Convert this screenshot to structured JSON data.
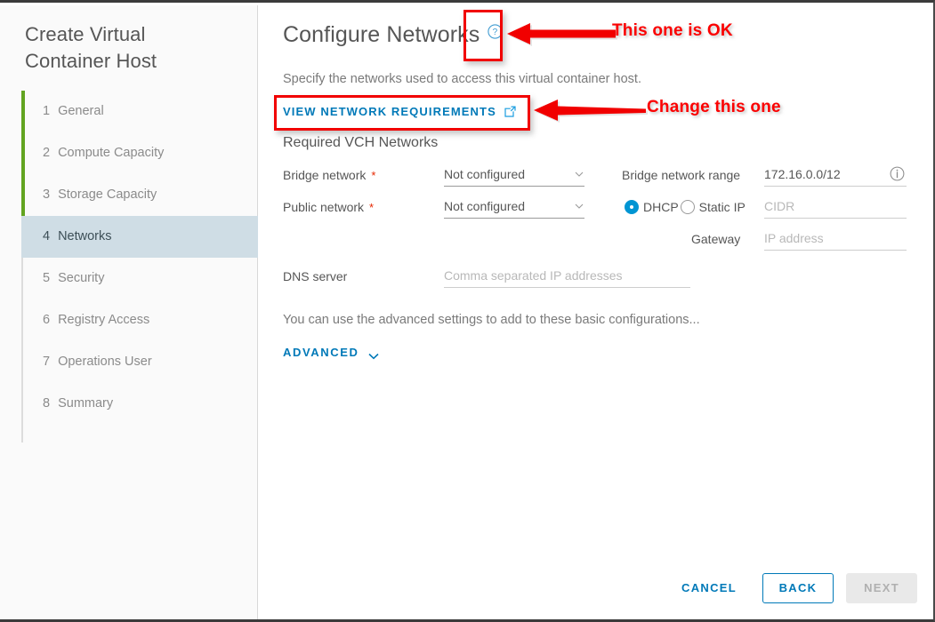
{
  "wizard": {
    "title": "Create Virtual\nContainer Host",
    "steps": [
      {
        "num": "1",
        "label": "General",
        "active": false
      },
      {
        "num": "2",
        "label": "Compute Capacity",
        "active": false
      },
      {
        "num": "3",
        "label": "Storage Capacity",
        "active": false
      },
      {
        "num": "4",
        "label": "Networks",
        "active": true
      },
      {
        "num": "5",
        "label": "Security",
        "active": false
      },
      {
        "num": "6",
        "label": "Registry Access",
        "active": false
      },
      {
        "num": "7",
        "label": "Operations User",
        "active": false
      },
      {
        "num": "8",
        "label": "Summary",
        "active": false
      }
    ],
    "rail_color": "#62a420",
    "active_bg": "#cfdde5"
  },
  "page": {
    "title": "Configure Networks",
    "help_icon": "help-circle-icon",
    "description": "Specify the networks used to access this virtual container host.",
    "requirements_link": "VIEW NETWORK REQUIREMENTS",
    "requirements_link_icon": "external-link-icon",
    "section_heading": "Required VCH Networks"
  },
  "form": {
    "bridge_network": {
      "label": "Bridge network",
      "required_marker": "*",
      "value": "Not configured",
      "caret_icon": "chevron-down-icon"
    },
    "public_network": {
      "label": "Public network",
      "required_marker": "*",
      "value": "Not configured",
      "caret_icon": "chevron-down-icon"
    },
    "bridge_network_range": {
      "label": "Bridge network range",
      "value": "172.16.0.0/12",
      "info_icon": "info-circle-icon"
    },
    "ip_mode": {
      "dhcp_label": "DHCP",
      "static_label": "Static IP",
      "selected": "DHCP"
    },
    "cidr": {
      "placeholder": "CIDR",
      "value": ""
    },
    "gateway": {
      "label": "Gateway",
      "placeholder": "IP address",
      "value": ""
    },
    "dns_server": {
      "label": "DNS server",
      "placeholder": "Comma separated IP addresses",
      "value": ""
    }
  },
  "advanced": {
    "note": "You can use the advanced settings to add to these basic configurations...",
    "button_label": "ADVANCED",
    "chevron_icon": "chevron-down-icon"
  },
  "footer": {
    "cancel": "CANCEL",
    "back": "BACK",
    "next": "NEXT"
  },
  "annotations": {
    "color": "#fb0000",
    "callout_top": "This one is OK",
    "callout_bottom": "Change this one"
  }
}
